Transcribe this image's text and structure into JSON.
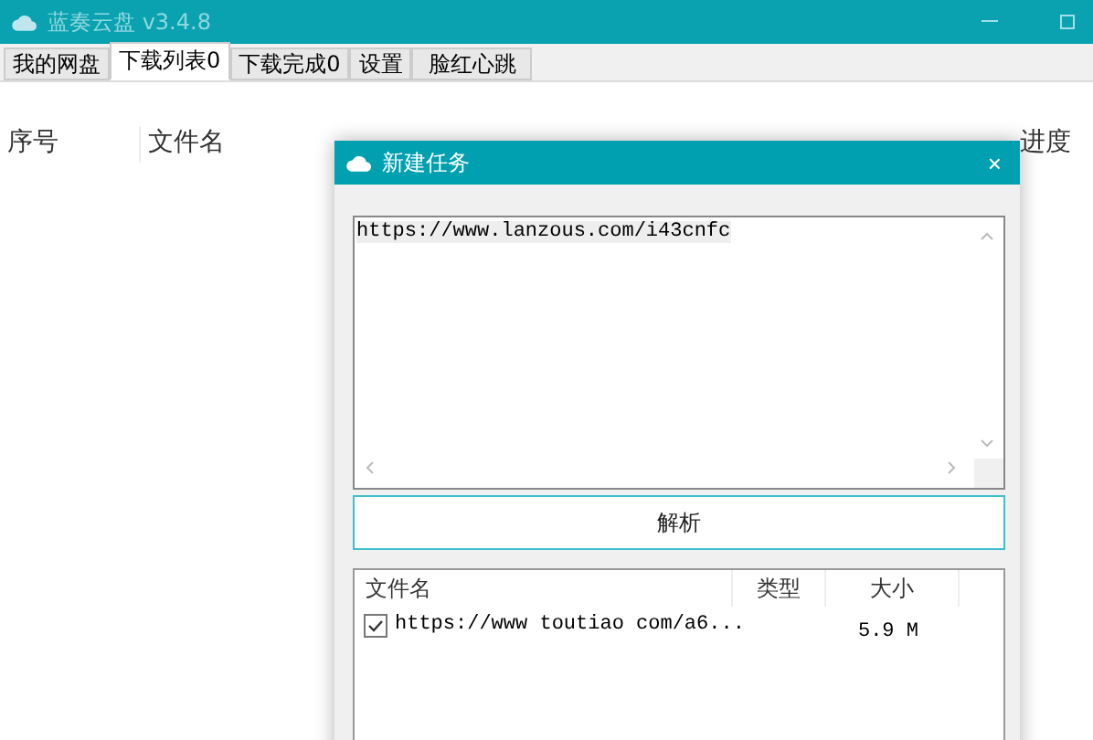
{
  "window": {
    "title": "蓝奏云盘 v3.4.8"
  },
  "tabs": [
    {
      "label": "我的网盘",
      "selected": false
    },
    {
      "label": "下载列表0",
      "selected": true
    },
    {
      "label": "下载完成0",
      "selected": false
    },
    {
      "label": "设置",
      "selected": false
    },
    {
      "label": "脸红心跳",
      "selected": false
    }
  ],
  "table": {
    "columns": [
      "序号",
      "文件名",
      "进度"
    ]
  },
  "dialog": {
    "title": "新建任务",
    "close": "×",
    "url_input": "https://www.lanzous.com/i43cnfc",
    "parse_button": "解析",
    "file_list": {
      "columns": [
        "文件名",
        "类型",
        "大小"
      ],
      "rows": [
        {
          "name": "https://www toutiao com/a6...",
          "size": "5.9 M",
          "checked": true
        }
      ]
    }
  }
}
